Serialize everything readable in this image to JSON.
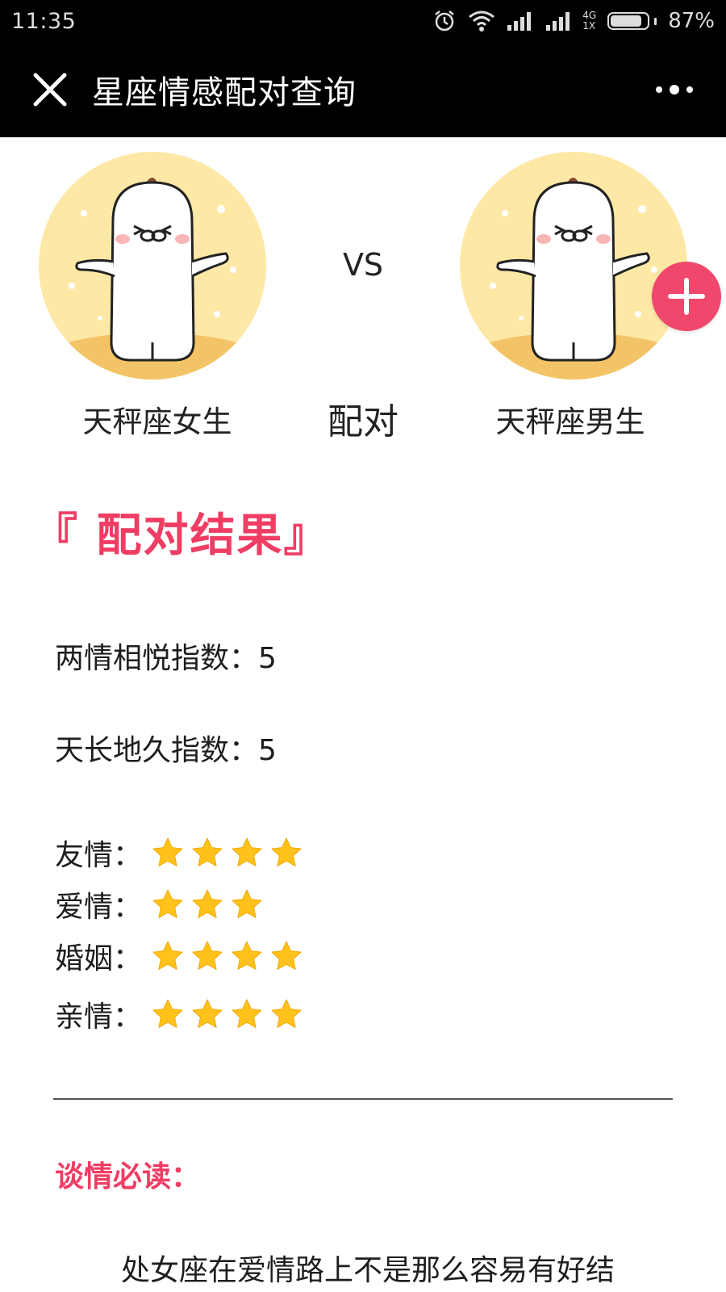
{
  "status_bar": {
    "time": "11:35",
    "network_top": "4G",
    "network_bottom": "1X",
    "battery_text": "87%",
    "battery_level": 0.87,
    "icons": [
      "alarm-icon",
      "wifi-icon",
      "signal-icon",
      "signal-icon-2",
      "battery-icon"
    ]
  },
  "header": {
    "title": "星座情感配对查询",
    "close_icon": "close-icon",
    "more_icon": "more-icon"
  },
  "pairing": {
    "left_name": "天秤座女生",
    "right_name": "天秤座男生",
    "vs_text": "VS",
    "pair_text": "配对",
    "add_icon": "plus-icon"
  },
  "result": {
    "heading": "『 配对结果』",
    "index_1": "两情相悦指数：5",
    "index_2": "天长地久指数：5",
    "ratings": [
      {
        "label": "友情：",
        "stars": 4
      },
      {
        "label": "爱情：",
        "stars": 3
      },
      {
        "label": "婚姻：",
        "stars": 4
      },
      {
        "label": "亲情：",
        "stars": 4
      }
    ]
  },
  "reading": {
    "title": "谈情必读：",
    "paragraph": "处女座在爱情路上不是那么容易有好结"
  },
  "colors": {
    "accent": "#ef3d64",
    "star": "#ffc21a",
    "avatar_bg": "#fde8a6",
    "bar": "#000000"
  }
}
